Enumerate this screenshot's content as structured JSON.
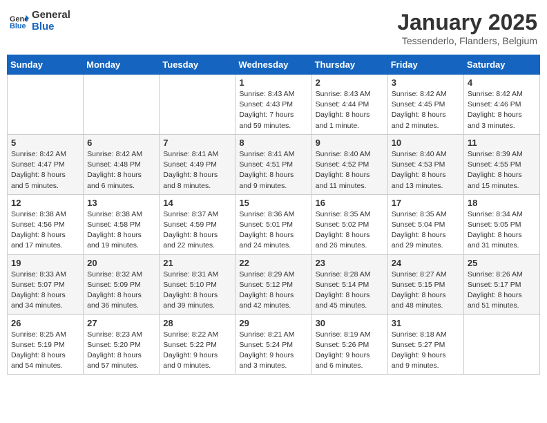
{
  "header": {
    "logo_general": "General",
    "logo_blue": "Blue",
    "title": "January 2025",
    "subtitle": "Tessenderlo, Flanders, Belgium"
  },
  "weekdays": [
    "Sunday",
    "Monday",
    "Tuesday",
    "Wednesday",
    "Thursday",
    "Friday",
    "Saturday"
  ],
  "weeks": [
    [
      {
        "day": "",
        "info": ""
      },
      {
        "day": "",
        "info": ""
      },
      {
        "day": "",
        "info": ""
      },
      {
        "day": "1",
        "info": "Sunrise: 8:43 AM\nSunset: 4:43 PM\nDaylight: 7 hours and 59 minutes."
      },
      {
        "day": "2",
        "info": "Sunrise: 8:43 AM\nSunset: 4:44 PM\nDaylight: 8 hours and 1 minute."
      },
      {
        "day": "3",
        "info": "Sunrise: 8:42 AM\nSunset: 4:45 PM\nDaylight: 8 hours and 2 minutes."
      },
      {
        "day": "4",
        "info": "Sunrise: 8:42 AM\nSunset: 4:46 PM\nDaylight: 8 hours and 3 minutes."
      }
    ],
    [
      {
        "day": "5",
        "info": "Sunrise: 8:42 AM\nSunset: 4:47 PM\nDaylight: 8 hours and 5 minutes."
      },
      {
        "day": "6",
        "info": "Sunrise: 8:42 AM\nSunset: 4:48 PM\nDaylight: 8 hours and 6 minutes."
      },
      {
        "day": "7",
        "info": "Sunrise: 8:41 AM\nSunset: 4:49 PM\nDaylight: 8 hours and 8 minutes."
      },
      {
        "day": "8",
        "info": "Sunrise: 8:41 AM\nSunset: 4:51 PM\nDaylight: 8 hours and 9 minutes."
      },
      {
        "day": "9",
        "info": "Sunrise: 8:40 AM\nSunset: 4:52 PM\nDaylight: 8 hours and 11 minutes."
      },
      {
        "day": "10",
        "info": "Sunrise: 8:40 AM\nSunset: 4:53 PM\nDaylight: 8 hours and 13 minutes."
      },
      {
        "day": "11",
        "info": "Sunrise: 8:39 AM\nSunset: 4:55 PM\nDaylight: 8 hours and 15 minutes."
      }
    ],
    [
      {
        "day": "12",
        "info": "Sunrise: 8:38 AM\nSunset: 4:56 PM\nDaylight: 8 hours and 17 minutes."
      },
      {
        "day": "13",
        "info": "Sunrise: 8:38 AM\nSunset: 4:58 PM\nDaylight: 8 hours and 19 minutes."
      },
      {
        "day": "14",
        "info": "Sunrise: 8:37 AM\nSunset: 4:59 PM\nDaylight: 8 hours and 22 minutes."
      },
      {
        "day": "15",
        "info": "Sunrise: 8:36 AM\nSunset: 5:01 PM\nDaylight: 8 hours and 24 minutes."
      },
      {
        "day": "16",
        "info": "Sunrise: 8:35 AM\nSunset: 5:02 PM\nDaylight: 8 hours and 26 minutes."
      },
      {
        "day": "17",
        "info": "Sunrise: 8:35 AM\nSunset: 5:04 PM\nDaylight: 8 hours and 29 minutes."
      },
      {
        "day": "18",
        "info": "Sunrise: 8:34 AM\nSunset: 5:05 PM\nDaylight: 8 hours and 31 minutes."
      }
    ],
    [
      {
        "day": "19",
        "info": "Sunrise: 8:33 AM\nSunset: 5:07 PM\nDaylight: 8 hours and 34 minutes."
      },
      {
        "day": "20",
        "info": "Sunrise: 8:32 AM\nSunset: 5:09 PM\nDaylight: 8 hours and 36 minutes."
      },
      {
        "day": "21",
        "info": "Sunrise: 8:31 AM\nSunset: 5:10 PM\nDaylight: 8 hours and 39 minutes."
      },
      {
        "day": "22",
        "info": "Sunrise: 8:29 AM\nSunset: 5:12 PM\nDaylight: 8 hours and 42 minutes."
      },
      {
        "day": "23",
        "info": "Sunrise: 8:28 AM\nSunset: 5:14 PM\nDaylight: 8 hours and 45 minutes."
      },
      {
        "day": "24",
        "info": "Sunrise: 8:27 AM\nSunset: 5:15 PM\nDaylight: 8 hours and 48 minutes."
      },
      {
        "day": "25",
        "info": "Sunrise: 8:26 AM\nSunset: 5:17 PM\nDaylight: 8 hours and 51 minutes."
      }
    ],
    [
      {
        "day": "26",
        "info": "Sunrise: 8:25 AM\nSunset: 5:19 PM\nDaylight: 8 hours and 54 minutes."
      },
      {
        "day": "27",
        "info": "Sunrise: 8:23 AM\nSunset: 5:20 PM\nDaylight: 8 hours and 57 minutes."
      },
      {
        "day": "28",
        "info": "Sunrise: 8:22 AM\nSunset: 5:22 PM\nDaylight: 9 hours and 0 minutes."
      },
      {
        "day": "29",
        "info": "Sunrise: 8:21 AM\nSunset: 5:24 PM\nDaylight: 9 hours and 3 minutes."
      },
      {
        "day": "30",
        "info": "Sunrise: 8:19 AM\nSunset: 5:26 PM\nDaylight: 9 hours and 6 minutes."
      },
      {
        "day": "31",
        "info": "Sunrise: 8:18 AM\nSunset: 5:27 PM\nDaylight: 9 hours and 9 minutes."
      },
      {
        "day": "",
        "info": ""
      }
    ]
  ]
}
